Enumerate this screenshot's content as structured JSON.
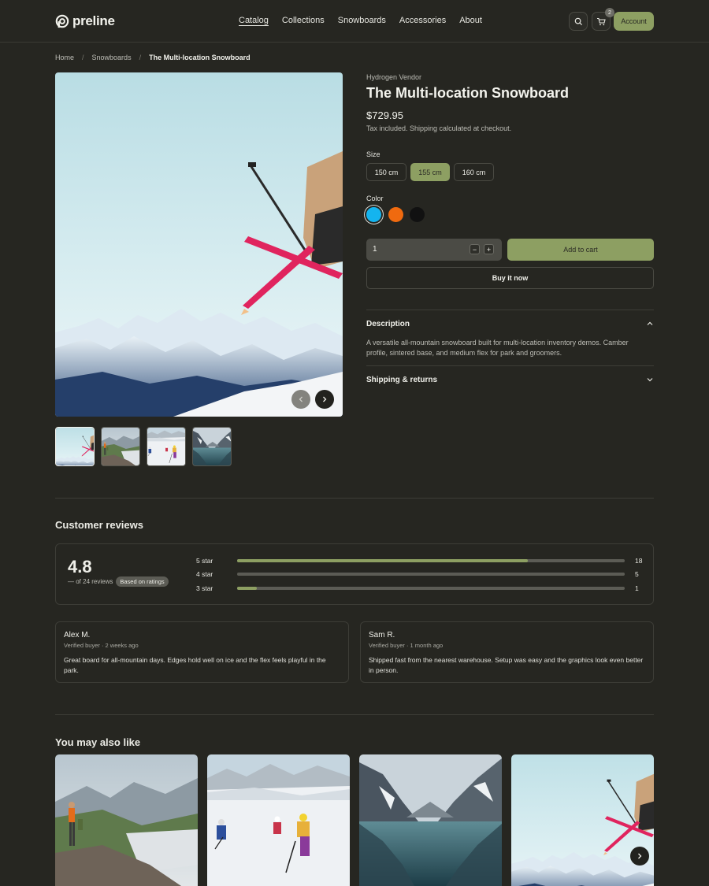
{
  "header": {
    "brand": "preline",
    "nav": [
      {
        "label": "Catalog",
        "active": true
      },
      {
        "label": "Collections",
        "active": false
      },
      {
        "label": "Snowboards",
        "active": false
      },
      {
        "label": "Accessories",
        "active": false
      },
      {
        "label": "About",
        "active": false
      }
    ],
    "cart_count": "2",
    "account_label": "Account",
    "accent_color": "#8d9f62"
  },
  "breadcrumb": {
    "items": [
      "Home",
      "Snowboards"
    ],
    "separator": "/",
    "current": "The Multi-location Snowboard"
  },
  "product": {
    "vendor": "Hydrogen Vendor",
    "title": "The Multi-location Snowboard",
    "price": "$729.95",
    "tax_note": "Tax included. Shipping calculated at checkout.",
    "size_label": "Size",
    "sizes": [
      {
        "label": "150 cm",
        "selected": false
      },
      {
        "label": "155 cm",
        "selected": true
      },
      {
        "label": "160 cm",
        "selected": false
      }
    ],
    "color_label": "Color",
    "colors": [
      {
        "name": "cyan",
        "hex": "#14b4ef",
        "selected": true
      },
      {
        "name": "orange",
        "hex": "#f06a0f",
        "selected": false
      },
      {
        "name": "black",
        "hex": "#111111",
        "selected": false
      }
    ],
    "quantity": "1",
    "minus": "−",
    "plus": "+",
    "add_to_cart": "Add to cart",
    "buy_now": "Buy it now",
    "accordion": [
      {
        "title": "Description",
        "open": true,
        "body": "A versatile all-mountain snowboard built for multi-location inventory demos. Camber profile, sintered base, and medium flex for park and groomers."
      },
      {
        "title": "Shipping & returns",
        "open": false
      }
    ]
  },
  "gallery": {
    "prev_icon": "chevron-left-icon",
    "next_icon": "chevron-right-icon",
    "thumbnails": [
      "skier-jump",
      "hikers-cliff",
      "skiers-slope",
      "mountain-lake"
    ]
  },
  "reviews": {
    "title": "Customer reviews",
    "average": "4.8",
    "count_text": "— of 24 reviews",
    "badge": "Based on ratings",
    "distribution": [
      {
        "label": "5 star",
        "count": "18",
        "fraction": 0.75
      },
      {
        "label": "4 star",
        "count": "5",
        "fraction": 0.0
      },
      {
        "label": "3 star",
        "count": "1",
        "fraction": 0.05
      }
    ],
    "items": [
      {
        "name": "Alex M.",
        "meta": "Verified buyer · 2 weeks ago",
        "text": "Great board for all-mountain days. Edges hold well on ice and the flex feels playful in the park."
      },
      {
        "name": "Sam R.",
        "meta": "Verified buyer · 1 month ago",
        "text": "Shipped fast from the nearest warehouse. Setup was easy and the graphics look even better in person."
      }
    ]
  },
  "related": {
    "title": "You may also like",
    "items": [
      "hikers-cliff",
      "skiers-slope",
      "mountain-lake",
      "skier-jump"
    ],
    "next_icon": "chevron-right-icon"
  }
}
